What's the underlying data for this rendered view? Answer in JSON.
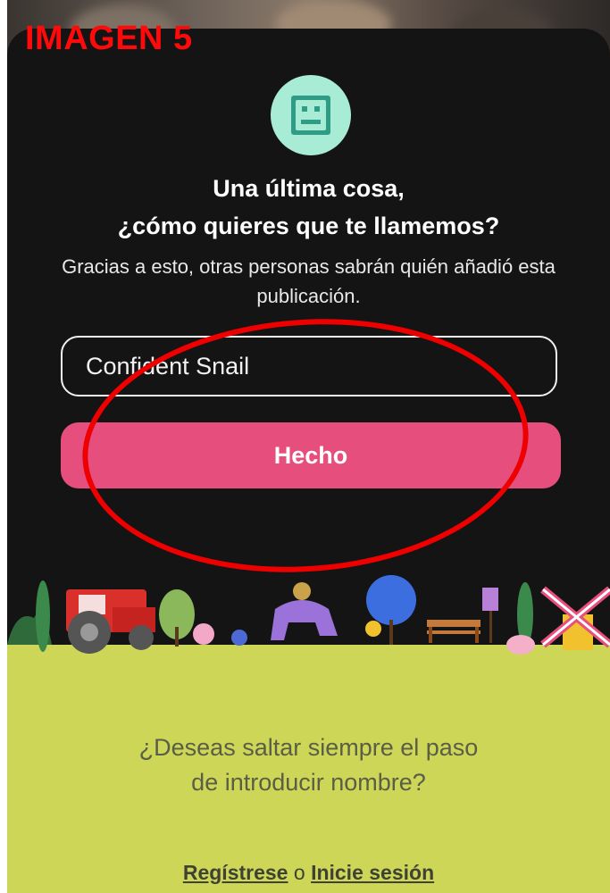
{
  "caption": "IMAGEN 5",
  "avatar": {
    "icon": "robot-face-icon",
    "color": "#a8ecd5"
  },
  "heading": {
    "line1": "Una última cosa,",
    "line2": "¿cómo quieres que te llamemos?"
  },
  "subtitle": "Gracias a esto, otras personas sabrán quién añadió esta publicación.",
  "name_field": {
    "value": "Confident Snail"
  },
  "done_button": {
    "label": "Hecho",
    "color": "#e64e7e"
  },
  "illustration": {
    "name": "farm-scene-illustration"
  },
  "prompt": {
    "line1": "¿Deseas saltar siempre el paso",
    "line2": "de introducir nombre?"
  },
  "auth_links": {
    "register": "Regístrese",
    "separator": "o",
    "login": "Inicie sesión"
  }
}
